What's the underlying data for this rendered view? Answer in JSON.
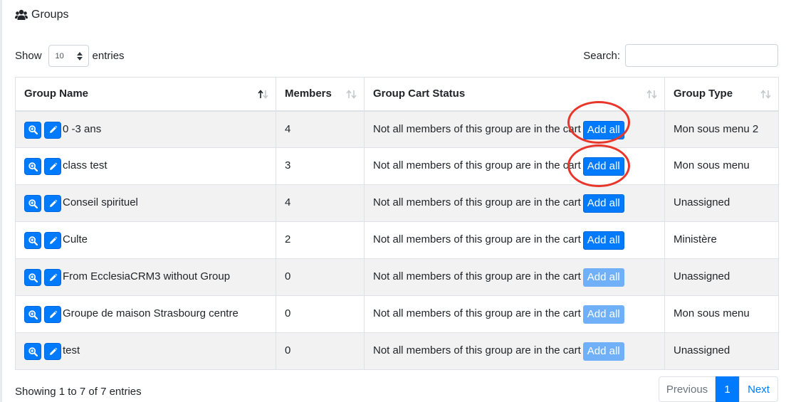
{
  "header": {
    "title": "Groups",
    "icon": "users-icon"
  },
  "length_control": {
    "show_label": "Show",
    "value": "10",
    "entries_label": "entries"
  },
  "search": {
    "label": "Search:",
    "value": ""
  },
  "table": {
    "columns": [
      "Group Name",
      "Members",
      "Group Cart Status",
      "Group Type"
    ],
    "rows": [
      {
        "name": "0 -3 ans",
        "members": "4",
        "status": "Not all members of this group are in the cart",
        "action": "Add all",
        "type": "Mon sous menu 2",
        "action_enabled": true
      },
      {
        "name": "class test",
        "members": "3",
        "status": "Not all members of this group are in the cart",
        "action": "Add all",
        "type": "Mon sous menu",
        "action_enabled": true
      },
      {
        "name": "Conseil spirituel",
        "members": "4",
        "status": "Not all members of this group are in the cart",
        "action": "Add all",
        "type": "Unassigned",
        "action_enabled": true
      },
      {
        "name": "Culte",
        "members": "2",
        "status": "Not all members of this group are in the cart",
        "action": "Add all",
        "type": "Ministère",
        "action_enabled": true
      },
      {
        "name": "From EcclesiaCRM3 without Group",
        "members": "0",
        "status": "Not all members of this group are in the cart",
        "action": "Add all",
        "type": "Unassigned",
        "action_enabled": false
      },
      {
        "name": "Groupe de maison Strasbourg centre",
        "members": "0",
        "status": "Not all members of this group are in the cart",
        "action": "Add all",
        "type": "Mon sous menu",
        "action_enabled": false
      },
      {
        "name": "test",
        "members": "0",
        "status": "Not all members of this group are in the cart",
        "action": "Add all",
        "type": "Unassigned",
        "action_enabled": false
      }
    ]
  },
  "footer": {
    "info": "Showing 1 to 7 of 7 entries"
  },
  "pagination": {
    "previous": "Previous",
    "current": "1",
    "next": "Next"
  },
  "colors": {
    "primary": "#007bff",
    "primary_disabled": "#6fb0f8",
    "annotation": "#e8362a",
    "row_stripe": "#f2f2f2"
  }
}
